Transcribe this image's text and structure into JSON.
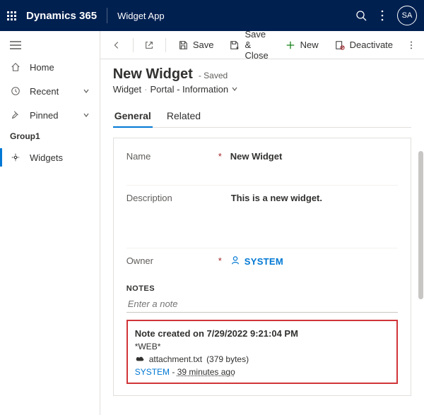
{
  "topbar": {
    "brand": "Dynamics 365",
    "app": "Widget App",
    "avatar": "SA"
  },
  "sidebar": {
    "items": [
      {
        "icon": "home",
        "label": "Home"
      },
      {
        "icon": "recent",
        "label": "Recent",
        "chevron": true
      },
      {
        "icon": "pinned",
        "label": "Pinned",
        "chevron": true
      }
    ],
    "group_label": "Group1",
    "selected": {
      "icon": "widget",
      "label": "Widgets"
    }
  },
  "commands": {
    "save": "Save",
    "save_close": "Save & Close",
    "new": "New",
    "deactivate": "Deactivate"
  },
  "header": {
    "title": "New Widget",
    "status": "- Saved",
    "entity": "Widget",
    "form": "Portal - Information"
  },
  "tabs": {
    "general": "General",
    "related": "Related"
  },
  "fields": {
    "name_label": "Name",
    "name_value": "New Widget",
    "desc_label": "Description",
    "desc_value": "This is a new widget.",
    "owner_label": "Owner",
    "owner_value": "SYSTEM"
  },
  "notes": {
    "heading": "NOTES",
    "placeholder": "Enter a note",
    "title": "Note created on 7/29/2022 9:21:04 PM",
    "web": "*WEB*",
    "attachment_name": "attachment.txt",
    "attachment_size": "(379 bytes)",
    "author": "SYSTEM",
    "when": "39 minutes ago"
  }
}
